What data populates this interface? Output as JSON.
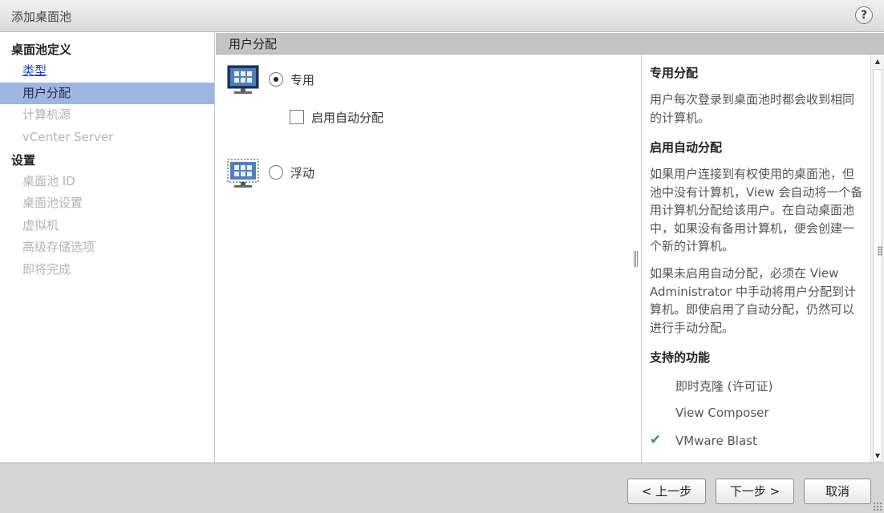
{
  "window": {
    "title": "添加桌面池",
    "help_label": "?"
  },
  "sidebar": {
    "section1": "桌面池定义",
    "section2": "设置",
    "items": [
      {
        "label": "类型",
        "state": "link"
      },
      {
        "label": "用户分配",
        "state": "active"
      },
      {
        "label": "计算机源",
        "state": "disabled"
      },
      {
        "label": "vCenter Server",
        "state": "disabled"
      },
      {
        "label": "桌面池 ID",
        "state": "disabled"
      },
      {
        "label": "桌面池设置",
        "state": "disabled"
      },
      {
        "label": "虚拟机",
        "state": "disabled"
      },
      {
        "label": "高级存储选项",
        "state": "disabled"
      },
      {
        "label": "即将完成",
        "state": "disabled"
      }
    ]
  },
  "content": {
    "header": "用户分配",
    "options": {
      "dedicated": {
        "label": "专用",
        "checked": true,
        "icon": "monitor-icon"
      },
      "auto_assign": {
        "label": "启用自动分配",
        "checked": false
      },
      "floating": {
        "label": "浮动",
        "checked": false,
        "icon": "floating-monitor-icon"
      }
    }
  },
  "help": {
    "h1": "专用分配",
    "p1": "用户每次登录到桌面池时都会收到相同的计算机。",
    "h2": "启用自动分配",
    "p2": "如果用户连接到有权使用的桌面池，但池中没有计算机，View 会自动将一个备用计算机分配给该用户。在自动桌面池中，如果没有备用计算机，便会创建一个新的计算机。",
    "p3": "如果未启用自动分配，必须在 View Administrator 中手动将用户分配到计算机。即使启用了自动分配，仍然可以进行手动分配。",
    "h3": "支持的功能",
    "features": [
      {
        "label": "即时克隆 (许可证)",
        "supported": false
      },
      {
        "label": "View Composer",
        "supported": false
      },
      {
        "label": "VMware Blast",
        "supported": true
      }
    ]
  },
  "footer": {
    "back": "< 上一步",
    "next": "下一步 >",
    "cancel": "取消"
  },
  "colors": {
    "active_item": "#9db5e0",
    "link": "#1a44d9",
    "check": "#3ca23c"
  }
}
